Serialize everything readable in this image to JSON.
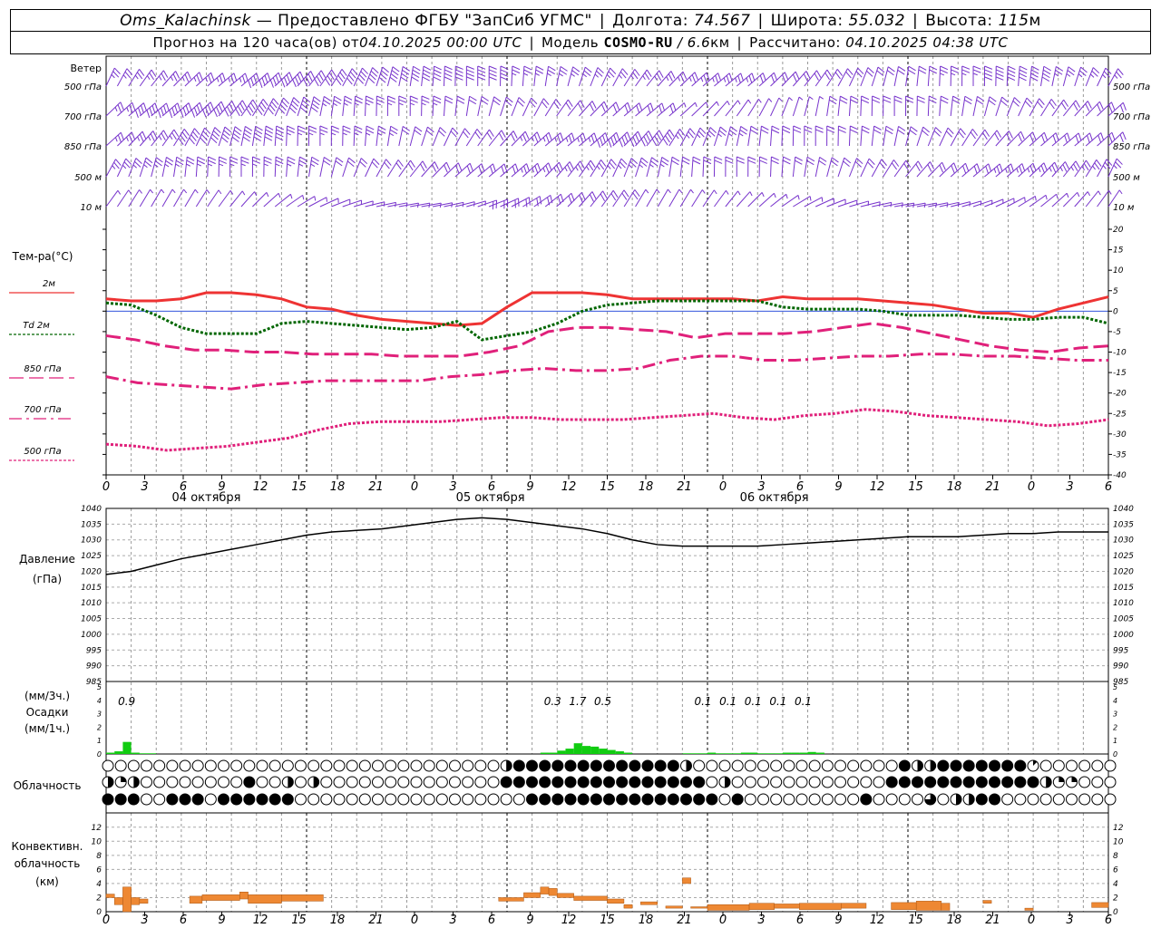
{
  "header": {
    "station": "Oms_Kalachinsk",
    "provided_by": "—  Предоставлено ФГБУ \"ЗапСиб УГМС\"",
    "lon_label": "Долгота:",
    "lon_value": "74.567",
    "lat_label": "Широта:",
    "lat_value": "55.032",
    "alt_label": "Высота:",
    "alt_value": "115",
    "alt_unit": "м",
    "forecast_prefix": "Прогноз на 120 часа(ов)  от ",
    "forecast_start": "04.10.2025 00:00 UTC",
    "model_label": "Модель",
    "model_name": "COSMO-RU",
    "model_res": "/ 6.6",
    "model_res_unit": "км",
    "computed_label": "Рассчитано:",
    "computed_value": "04.10.2025 04:38 UTC"
  },
  "axis": {
    "hour_ticks": [
      "0",
      "3",
      "6",
      "9",
      "12",
      "15",
      "18",
      "21",
      "0",
      "3",
      "6",
      "9",
      "12",
      "15",
      "18",
      "21",
      "0",
      "3",
      "6",
      "9",
      "12",
      "15",
      "18",
      "21",
      "0",
      "3",
      "6"
    ],
    "dates": [
      "04 октября",
      "05 октября",
      "06 октября"
    ]
  },
  "wind_panel": {
    "title": "Ветер",
    "levels": [
      "500 гПа",
      "700 гПа",
      "850 гПа",
      "500 м",
      "10  м"
    ]
  },
  "temp_panel": {
    "title": "Тем-ра(°C)",
    "legend": [
      {
        "label": "2м",
        "color": "#ee3333"
      },
      {
        "label": "Td  2м",
        "color": "#006600"
      },
      {
        "label": "850 гПа",
        "color": "#e0207a"
      },
      {
        "label": "700 гПа",
        "color": "#e0207a"
      },
      {
        "label": "500 гПа",
        "color": "#e0207a"
      }
    ],
    "y_ticks": [
      "20",
      "15",
      "10",
      "5",
      "0",
      "-5",
      "-10",
      "-15",
      "-20",
      "-25",
      "-30",
      "-35",
      "-40"
    ]
  },
  "pressure_panel": {
    "title": "Давление",
    "unit": "(гПа)",
    "y_ticks": [
      "1040",
      "1035",
      "1030",
      "1025",
      "1020",
      "1015",
      "1010",
      "1005",
      "1000",
      "995",
      "990",
      "985"
    ]
  },
  "precip_panel": {
    "unit_3h": "(мм/3ч.)",
    "title": "Осадки",
    "unit_1h": "(мм/1ч.)",
    "y_ticks": [
      "5",
      "4",
      "3",
      "2",
      "1",
      "0"
    ],
    "totals": [
      {
        "hour": 3,
        "text": "0.9"
      },
      {
        "hour": 54,
        "text": "0.3"
      },
      {
        "hour": 57,
        "text": "1.7"
      },
      {
        "hour": 60,
        "text": "0.5"
      },
      {
        "hour": 72,
        "text": "0.1"
      },
      {
        "hour": 75,
        "text": "0.1"
      },
      {
        "hour": 78,
        "text": "0.1"
      },
      {
        "hour": 81,
        "text": "0.1"
      },
      {
        "hour": 84,
        "text": "0.1"
      }
    ]
  },
  "cloud_panel": {
    "title": "Облачность"
  },
  "conv_panel": {
    "title_1": "Конвективн.",
    "title_2": "облачность",
    "unit": "(км)",
    "y_ticks": [
      "12",
      "10",
      "8",
      "6",
      "4",
      "2",
      "0"
    ]
  },
  "chart_data": [
    {
      "type": "wind-barbs",
      "levels": [
        "500 гПа",
        "700 гПа",
        "850 гПа",
        "500 м",
        "10 м"
      ],
      "color": "#7733cc",
      "note_speed": [
        [
          15,
          15,
          15,
          15,
          20,
          20,
          20,
          20,
          20,
          20,
          20,
          15,
          15,
          15,
          15,
          15,
          15,
          10,
          10,
          10,
          10,
          10,
          15,
          20,
          20,
          15,
          15
        ],
        [
          15,
          20,
          20,
          20,
          20,
          20,
          15,
          15,
          15,
          10,
          10,
          10,
          10,
          10,
          10,
          5,
          5,
          5,
          5,
          10,
          10,
          10,
          10,
          10,
          10,
          10,
          10
        ],
        [
          15,
          15,
          20,
          20,
          20,
          15,
          15,
          15,
          10,
          10,
          10,
          15,
          15,
          20,
          20,
          15,
          15,
          10,
          10,
          10,
          10,
          10,
          10,
          10,
          10,
          10,
          10
        ],
        [
          15,
          15,
          15,
          15,
          15,
          15,
          10,
          10,
          10,
          10,
          10,
          15,
          15,
          15,
          15,
          10,
          10,
          10,
          10,
          10,
          10,
          10,
          10,
          15,
          15,
          15,
          15
        ],
        [
          5,
          5,
          5,
          5,
          5,
          5,
          5,
          5,
          5,
          5,
          10,
          10,
          10,
          10,
          5,
          5,
          5,
          5,
          5,
          5,
          5,
          5,
          5,
          5,
          5,
          5,
          5
        ]
      ]
    },
    {
      "type": "line",
      "x_hours": [
        0,
        3,
        6,
        9,
        12,
        15,
        18,
        21,
        24,
        27,
        30,
        33,
        36,
        39,
        42,
        45,
        48,
        51,
        54,
        57,
        60,
        63,
        66,
        69,
        72,
        75,
        78,
        81,
        84,
        87,
        90,
        93,
        96,
        99,
        102,
        105,
        108,
        111,
        114,
        117,
        120
      ],
      "xlim": [
        0,
        120
      ],
      "ylim": [
        -40,
        20
      ],
      "series": [
        {
          "name": "2м",
          "color": "#ee3333",
          "style": "solid",
          "values": [
            3,
            2.5,
            2.5,
            3,
            4.5,
            4.5,
            4,
            3,
            1,
            0.5,
            -1,
            -2,
            -2.5,
            -3,
            -3.5,
            -3,
            1,
            4.5,
            4.5,
            4.5,
            4,
            3,
            3,
            3,
            3,
            3,
            2.5,
            3.5,
            3,
            3,
            3,
            2.5,
            2,
            1.5,
            0.5,
            -0.5,
            -0.5,
            -1.5,
            0.5,
            2,
            3.5
          ]
        },
        {
          "name": "Td  2м",
          "color": "#006600",
          "style": "dotted",
          "values": [
            2,
            1.5,
            -1,
            -4,
            -5.5,
            -5.5,
            -5.5,
            -3,
            -2.5,
            -3,
            -3.5,
            -4,
            -4.5,
            -4,
            -2.5,
            -7,
            -6,
            -5,
            -3,
            0,
            1.5,
            2,
            2.5,
            2.5,
            2.5,
            2.5,
            2.5,
            1,
            0.5,
            0.5,
            0.5,
            0,
            -1,
            -1,
            -1,
            -1.5,
            -2,
            -2,
            -1.5,
            -1.5,
            -3
          ]
        },
        {
          "name": "850 гПа",
          "color": "#e0207a",
          "style": "longdash",
          "values": [
            -6,
            -7,
            -8.5,
            -9.5,
            -9.5,
            -10,
            -10,
            -10.5,
            -10.5,
            -10.5,
            -11,
            -11,
            -11,
            -10,
            -8.5,
            -5,
            -4,
            -4,
            -4.5,
            -5,
            -6.5,
            -5.5,
            -5.5,
            -5.5,
            -5,
            -4,
            -3,
            -4,
            -5.5,
            -7,
            -8.5,
            -9.5,
            -10,
            -9,
            -8.5
          ]
        },
        {
          "name": "700 гПа",
          "color": "#e0207a",
          "style": "dashdot",
          "values": [
            -16,
            -17.5,
            -18,
            -18.5,
            -19,
            -18,
            -17.5,
            -17,
            -17,
            -17,
            -17,
            -16,
            -15.5,
            -14.5,
            -14,
            -14.5,
            -14.5,
            -14,
            -12,
            -11,
            -11,
            -12,
            -12,
            -11.5,
            -11,
            -11,
            -10.5,
            -10.5,
            -11,
            -11,
            -11.5,
            -12,
            -12
          ]
        },
        {
          "name": "500 гПа",
          "color": "#e0207a",
          "style": "dotted",
          "values": [
            -32.5,
            -33,
            -34,
            -33.5,
            -33,
            -32,
            -31,
            -29,
            -27.5,
            -27,
            -27,
            -27,
            -26.5,
            -26,
            -26,
            -26.5,
            -26.5,
            -26.5,
            -26,
            -25.5,
            -25,
            -26,
            -26.5,
            -25.5,
            -25,
            -24,
            -24.5,
            -25.5,
            -26,
            -26.5,
            -27,
            -28,
            -27.5,
            -26.5
          ]
        }
      ]
    },
    {
      "type": "line",
      "name": "Давление",
      "ylim": [
        985,
        1040
      ],
      "x_hours": [
        0,
        3,
        6,
        9,
        12,
        15,
        18,
        21,
        24,
        27,
        30,
        33,
        36,
        39,
        42,
        45,
        48,
        51,
        54,
        57,
        60,
        63,
        66,
        69,
        72,
        75,
        78,
        81,
        84,
        87,
        90,
        93,
        96,
        99,
        102,
        105,
        108,
        111,
        114,
        117,
        120
      ],
      "values": [
        1019,
        1020,
        1022,
        1024,
        1025.5,
        1027,
        1028.5,
        1030,
        1031.5,
        1032.5,
        1033,
        1033.5,
        1034.5,
        1035.5,
        1036.5,
        1037,
        1036.5,
        1035.5,
        1034.5,
        1033.5,
        1032,
        1030,
        1028.5,
        1028,
        1028,
        1028,
        1028,
        1028.5,
        1029,
        1029.5,
        1030,
        1030.5,
        1031,
        1031,
        1031,
        1031.5,
        1032,
        1032,
        1032.5,
        1032.5,
        1032.5
      ]
    },
    {
      "type": "bar",
      "name": "Осадки (мм/1ч.)",
      "ylim": [
        0,
        5
      ],
      "color": "#11cc11",
      "x_hours": [
        0,
        1,
        2,
        3,
        4,
        5,
        52,
        53,
        54,
        55,
        56,
        57,
        58,
        59,
        60,
        61,
        62,
        69,
        70,
        71,
        72,
        73,
        74,
        75,
        76,
        77,
        78,
        79,
        80,
        81,
        82,
        83,
        84,
        85
      ],
      "values": [
        0.1,
        0.2,
        0.9,
        0.1,
        0.05,
        0.05,
        0.1,
        0.1,
        0.25,
        0.4,
        0.8,
        0.6,
        0.55,
        0.4,
        0.3,
        0.2,
        0.1,
        0.05,
        0.05,
        0.05,
        0.1,
        0.05,
        0.05,
        0.05,
        0.1,
        0.1,
        0.05,
        0.05,
        0.05,
        0.1,
        0.1,
        0.1,
        0.15,
        0.1
      ]
    },
    {
      "type": "table",
      "name": "Облачность",
      "note": "oktas 0-8 per hour for three cloud layers",
      "rows": [
        "000000000000000000000000000000000000004000400048888888888888888888840200000000000000000000048484848888888881000000000",
        "422400000000000048040400440000000000000000000008888888888888888888888880040000000000000000000888888888888888888424200000",
        "888880088888088888848800000000000000000000000000008888888888888888888888808000000000000000800000060048488800000000000000"
      ]
    },
    {
      "type": "bar",
      "name": "Конвективн. облачность (км)",
      "ylim": [
        0,
        13
      ],
      "color": "#ee8833",
      "segments": [
        {
          "from": 0,
          "to": 1,
          "base": 2,
          "top": 2.5
        },
        {
          "from": 1,
          "to": 2,
          "base": 1,
          "top": 2
        },
        {
          "from": 2,
          "to": 3,
          "base": 0,
          "top": 3.5
        },
        {
          "from": 3,
          "to": 4,
          "base": 1,
          "top": 2
        },
        {
          "from": 4,
          "to": 5,
          "base": 1.2,
          "top": 1.8
        },
        {
          "from": 10,
          "to": 11.5,
          "base": 1.2,
          "top": 2.2
        },
        {
          "from": 11.5,
          "to": 16,
          "base": 1.6,
          "top": 2.4
        },
        {
          "from": 16,
          "to": 17,
          "base": 1.8,
          "top": 2.8
        },
        {
          "from": 17,
          "to": 21,
          "base": 1.2,
          "top": 2.4
        },
        {
          "from": 21,
          "to": 26,
          "base": 1.5,
          "top": 2.4
        },
        {
          "from": 47,
          "to": 50,
          "base": 1.5,
          "top": 2.0
        },
        {
          "from": 50,
          "to": 52,
          "base": 2.0,
          "top": 2.7
        },
        {
          "from": 52,
          "to": 53,
          "base": 2.5,
          "top": 3.5
        },
        {
          "from": 53,
          "to": 54,
          "base": 2.3,
          "top": 3.3
        },
        {
          "from": 54,
          "to": 56,
          "base": 2.0,
          "top": 2.6
        },
        {
          "from": 56,
          "to": 60,
          "base": 1.6,
          "top": 2.2
        },
        {
          "from": 60,
          "to": 62,
          "base": 1.2,
          "top": 1.8
        },
        {
          "from": 62,
          "to": 63,
          "base": 0.5,
          "top": 1.0
        },
        {
          "from": 64,
          "to": 66,
          "base": 1.0,
          "top": 1.4
        },
        {
          "from": 67,
          "to": 69,
          "base": 0.5,
          "top": 0.8
        },
        {
          "from": 69,
          "to": 70,
          "base": 4,
          "top": 4.8
        },
        {
          "from": 70,
          "to": 72,
          "base": 0.5,
          "top": 0.7
        },
        {
          "from": 72,
          "to": 77,
          "base": 0.2,
          "top": 1.0
        },
        {
          "from": 77,
          "to": 80,
          "base": 0.3,
          "top": 1.2
        },
        {
          "from": 80,
          "to": 83,
          "base": 0.5,
          "top": 1.1
        },
        {
          "from": 83,
          "to": 88,
          "base": 0.3,
          "top": 1.2
        },
        {
          "from": 88,
          "to": 91,
          "base": 0.5,
          "top": 1.2
        },
        {
          "from": 94,
          "to": 97,
          "base": 0.3,
          "top": 1.3
        },
        {
          "from": 97,
          "to": 100,
          "base": 0.2,
          "top": 1.5
        },
        {
          "from": 100,
          "to": 101,
          "base": 0.2,
          "top": 1.2
        },
        {
          "from": 105,
          "to": 106,
          "base": 1.2,
          "top": 1.6
        },
        {
          "from": 110,
          "to": 111,
          "base": 0.2,
          "top": 0.5
        },
        {
          "from": 118,
          "to": 120,
          "base": 0.6,
          "top": 1.3
        }
      ]
    }
  ]
}
